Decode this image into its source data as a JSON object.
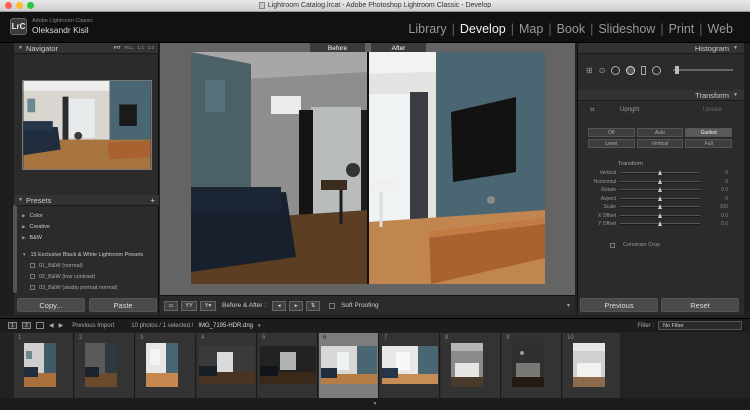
{
  "window": {
    "title": "Lightroom Catalog.lrcat - Adobe Photoshop Lightroom Classic - Develop"
  },
  "identity": {
    "logo": "LrC",
    "product": "Adobe Lightroom Classic",
    "user": "Oleksandr Kisil"
  },
  "modules": [
    {
      "label": "Library",
      "active": false
    },
    {
      "label": "Develop",
      "active": true
    },
    {
      "label": "Map",
      "active": false
    },
    {
      "label": "Book",
      "active": false
    },
    {
      "label": "Slideshow",
      "active": false
    },
    {
      "label": "Print",
      "active": false
    },
    {
      "label": "Web",
      "active": false
    }
  ],
  "navigator": {
    "title": "Navigator",
    "zooms": [
      "FIT",
      "FILL",
      "1:1",
      "1:3"
    ]
  },
  "presets": {
    "title": "Presets",
    "add_icon": "+",
    "items": [
      {
        "label": "Color",
        "level": 0
      },
      {
        "label": "Creative",
        "level": 0
      },
      {
        "label": "B&W",
        "level": 0
      },
      {
        "label": "15 Exclusive Black & White Lightroom Presets",
        "level": 0
      },
      {
        "label": "01_B&W (normal)",
        "level": 1
      },
      {
        "label": "02_B&W (low contrast)",
        "level": 1
      },
      {
        "label": "03_B&W (studio portrait normal)",
        "level": 1
      }
    ],
    "copy_label": "Copy...",
    "paste_label": "Paste"
  },
  "compare": {
    "before_label": "Before",
    "after_label": "After"
  },
  "toolbar": {
    "ba_label": "Before & After :",
    "soft_proofing": "Soft Proofing"
  },
  "histogram": {
    "title": "Histogram"
  },
  "transform": {
    "title": "Transform",
    "upright_label": "Upright",
    "update_label": "Update",
    "buttons": [
      "Off",
      "Auto",
      "Guided",
      "Level",
      "Vertical",
      "Full"
    ],
    "selected_button": "Guided",
    "section_label": "Transform",
    "sliders": [
      {
        "label": "Vertical",
        "value": "0"
      },
      {
        "label": "Horizontal",
        "value": "0"
      },
      {
        "label": "Rotate",
        "value": "0.0"
      },
      {
        "label": "Aspect",
        "value": "0"
      },
      {
        "label": "Scale",
        "value": "100"
      },
      {
        "label": "X Offset",
        "value": "0.0"
      },
      {
        "label": "Y Offset",
        "value": "0.0"
      }
    ],
    "constrain_crop": "Constrain Crop"
  },
  "right_buttons": {
    "previous": "Previous",
    "reset": "Reset"
  },
  "filmstrip_bar": {
    "page1": "1",
    "page2": "2",
    "source": "Previous Import",
    "count": "10 photos / 1 selected /",
    "filename": "IMG_7195-HDR.dng",
    "filter_label": "Filter :",
    "filter_value": "No Filter"
  },
  "filmstrip": {
    "cells": [
      {
        "num": "1"
      },
      {
        "num": "2"
      },
      {
        "num": "3"
      },
      {
        "num": "4"
      },
      {
        "num": "5"
      },
      {
        "num": "6"
      },
      {
        "num": "7"
      },
      {
        "num": "8"
      },
      {
        "num": "9"
      },
      {
        "num": "10"
      }
    ],
    "selected_index": 5
  },
  "colors": {
    "wall_blue": "#4a6673",
    "wood": "#a9612f",
    "sofa": "#1f2d3e",
    "active_module": "#f2f2f2"
  }
}
